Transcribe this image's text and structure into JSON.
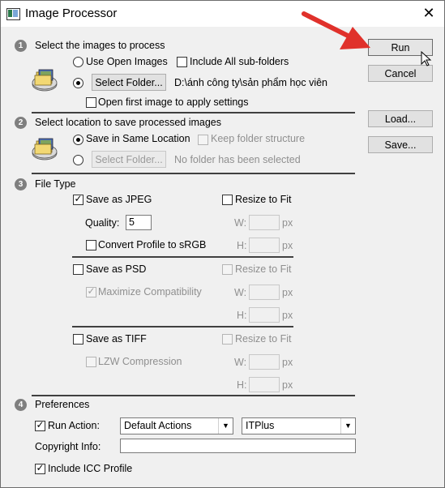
{
  "window": {
    "title": "Image Processor"
  },
  "buttons": {
    "run": "Run",
    "cancel": "Cancel",
    "load": "Load...",
    "save": "Save..."
  },
  "section1": {
    "number": "1",
    "title": "Select the images to process",
    "use_open_images": "Use Open Images",
    "include_subfolders": "Include All sub-folders",
    "select_folder": "Select Folder...",
    "folder_path": "D:\\ánh công ty\\sản phẩm học viên",
    "open_first_image": "Open first image to apply settings"
  },
  "section2": {
    "number": "2",
    "title": "Select location to save processed images",
    "save_same_location": "Save in Same Location",
    "keep_structure": "Keep folder structure",
    "select_folder": "Select Folder...",
    "no_folder": "No folder has been selected"
  },
  "section3": {
    "number": "3",
    "title": "File Type",
    "jpeg": {
      "label": "Save as JPEG",
      "resize": "Resize to Fit",
      "quality_label": "Quality:",
      "quality_value": "5",
      "w_label": "W:",
      "h_label": "H:",
      "unit": "px",
      "convert_profile": "Convert Profile to sRGB"
    },
    "psd": {
      "label": "Save as PSD",
      "resize": "Resize to Fit",
      "maximize": "Maximize Compatibility",
      "w_label": "W:",
      "h_label": "H:",
      "unit": "px"
    },
    "tiff": {
      "label": "Save as TIFF",
      "resize": "Resize to Fit",
      "lzw": "LZW Compression",
      "w_label": "W:",
      "h_label": "H:",
      "unit": "px"
    }
  },
  "section4": {
    "number": "4",
    "title": "Preferences",
    "run_action": "Run Action:",
    "action_set": "Default Actions",
    "action_name": "ITPlus",
    "copyright": "Copyright Info:",
    "copyright_value": "",
    "include_icc": "Include ICC Profile"
  },
  "checkmark": "✓",
  "close_glyph": "✕",
  "dropdown_glyph": "▼",
  "colors": {
    "arrow": "#e0312b",
    "badge": "#7f7f7f"
  }
}
